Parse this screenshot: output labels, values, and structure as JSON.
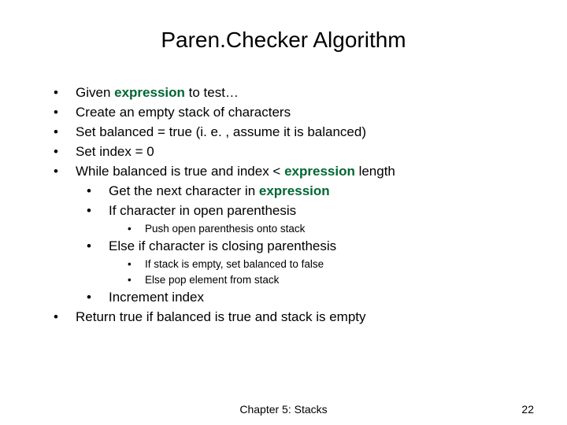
{
  "title": "Paren.Checker Algorithm",
  "kw": "expression",
  "items": {
    "i1a": "Given ",
    "i1b": " to test…",
    "i2": "Create an empty stack of characters",
    "i3": "Set balanced = true (i. e. , assume it is balanced)",
    "i4": "Set index = 0",
    "i5a": "While balanced is true and index < ",
    "i5b": " length",
    "i5_1a": "Get the next character in ",
    "i5_2": "If character in open parenthesis",
    "i5_2_1": "Push open parenthesis onto stack",
    "i5_3": "Else if character is closing parenthesis",
    "i5_3_1": "If stack is empty, set balanced to false",
    "i5_3_2": "Else pop element from stack",
    "i5_4": "Increment index",
    "i6": "Return true if balanced is true and stack is empty"
  },
  "footer": {
    "center": "Chapter 5: Stacks",
    "page": "22"
  }
}
